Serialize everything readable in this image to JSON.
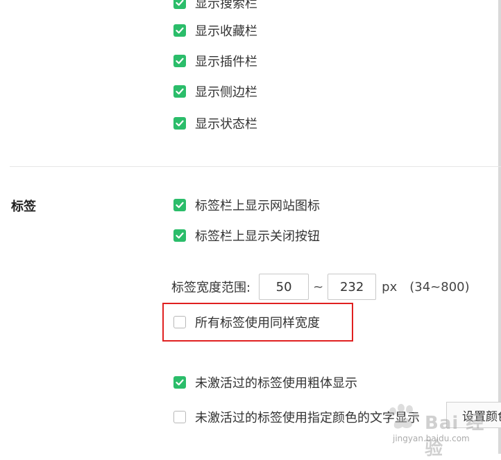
{
  "toolbar_options": [
    {
      "label": "显示搜索栏",
      "checked": true
    },
    {
      "label": "显示收藏栏",
      "checked": true
    },
    {
      "label": "显示插件栏",
      "checked": true
    },
    {
      "label": "显示侧边栏",
      "checked": true
    },
    {
      "label": "显示状态栏",
      "checked": true
    }
  ],
  "tabs_section": {
    "title": "标签",
    "options": [
      {
        "label": "标签栏上显示网站图标",
        "checked": true
      },
      {
        "label": "标签栏上显示关闭按钮",
        "checked": true
      }
    ],
    "width_range": {
      "label": "标签宽度范围:",
      "min_value": "50",
      "separator": "~",
      "max_value": "232",
      "unit": "px",
      "hint": "(34~800)"
    },
    "same_width": {
      "label": "所有标签使用同样宽度",
      "checked": false
    },
    "inactive_bold": {
      "label": "未激活过的标签使用粗体显示",
      "checked": true
    },
    "inactive_color": {
      "label": "未激活过的标签使用指定颜色的文字显示",
      "checked": false,
      "button_label": "设置颜色"
    }
  },
  "watermark": {
    "text": "Bai 经验",
    "url": "jingyan.baidu.com"
  },
  "colors": {
    "check_green": "#2bbd6a",
    "highlight_red": "#e02020"
  }
}
